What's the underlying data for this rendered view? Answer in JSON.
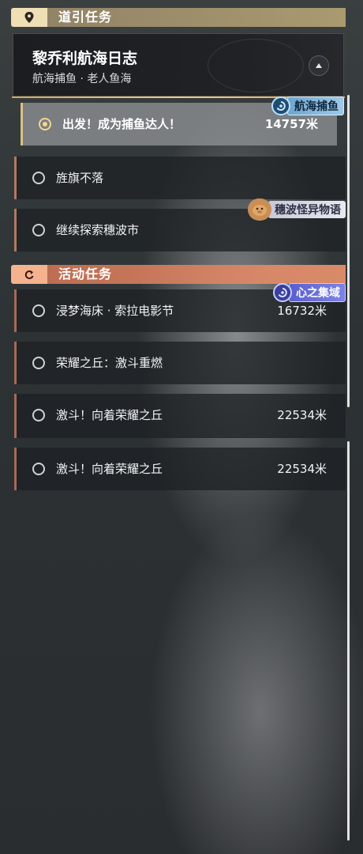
{
  "guide_section": {
    "title": "道引任务",
    "icon": "location-pin-icon"
  },
  "journal": {
    "title": "黎乔利航海日志",
    "subtitle": "航海捕鱼 · 老人鱼海",
    "collapse_icon": "triangle-up-icon"
  },
  "guide_tasks": [
    {
      "name": "出发！成为捕鱼达人！",
      "distance": "14757米",
      "selected": true,
      "tag": "航海捕鱼"
    },
    {
      "name": "旌旗不落",
      "distance": "",
      "selected": false,
      "tag": ""
    },
    {
      "name": "继续探索穗波市",
      "distance": "",
      "selected": false,
      "tag": "穗波怪异物语"
    }
  ],
  "activity_section": {
    "title": "活动任务",
    "icon": "refresh-icon"
  },
  "activity_tasks": [
    {
      "name": "浸梦海床 · 索拉电影节",
      "distance": "16732米",
      "tag": "心之集域"
    },
    {
      "name": "荣耀之丘：激斗重燃",
      "distance": ""
    },
    {
      "name": "激斗！向着荣耀之丘",
      "distance": "22534米"
    }
  ],
  "tags": {
    "fishing": {
      "label": "航海捕鱼",
      "icon": "fishing-swirl-icon"
    },
    "wave": {
      "label": "穗波怪异物语",
      "icon": "capybara-mascot-icon"
    },
    "heart": {
      "label": "心之集域",
      "icon": "heart-swirl-icon"
    }
  },
  "colors": {
    "guide_accent": "#c9a96a",
    "activity_accent": "#ec946e",
    "selected_radio": "#f3d792"
  }
}
